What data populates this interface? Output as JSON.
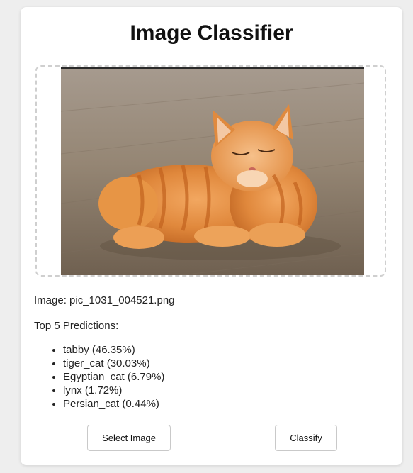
{
  "app": {
    "title": "Image Classifier"
  },
  "image": {
    "label_prefix": "Image: ",
    "filename": "pic_1031_004521.png",
    "filename_line": "Image: pic_1031_004521.png"
  },
  "predictions": {
    "heading": "Top 5 Predictions:",
    "items": [
      {
        "label": "tabby",
        "percent": "46.35%",
        "text": "tabby (46.35%)"
      },
      {
        "label": "tiger_cat",
        "percent": "30.03%",
        "text": "tiger_cat (30.03%)"
      },
      {
        "label": "Egyptian_cat",
        "percent": "6.79%",
        "text": "Egyptian_cat (6.79%)"
      },
      {
        "label": "lynx",
        "percent": "1.72%",
        "text": "lynx (1.72%)"
      },
      {
        "label": "Persian_cat",
        "percent": "0.44%",
        "text": "Persian_cat (0.44%)"
      }
    ]
  },
  "buttons": {
    "select_label": "Select Image",
    "classify_label": "Classify"
  },
  "colors": {
    "background": "#eeeeee",
    "card": "#ffffff",
    "dropzone_border": "#cfcfcf",
    "button_border": "#c9c9c9"
  }
}
